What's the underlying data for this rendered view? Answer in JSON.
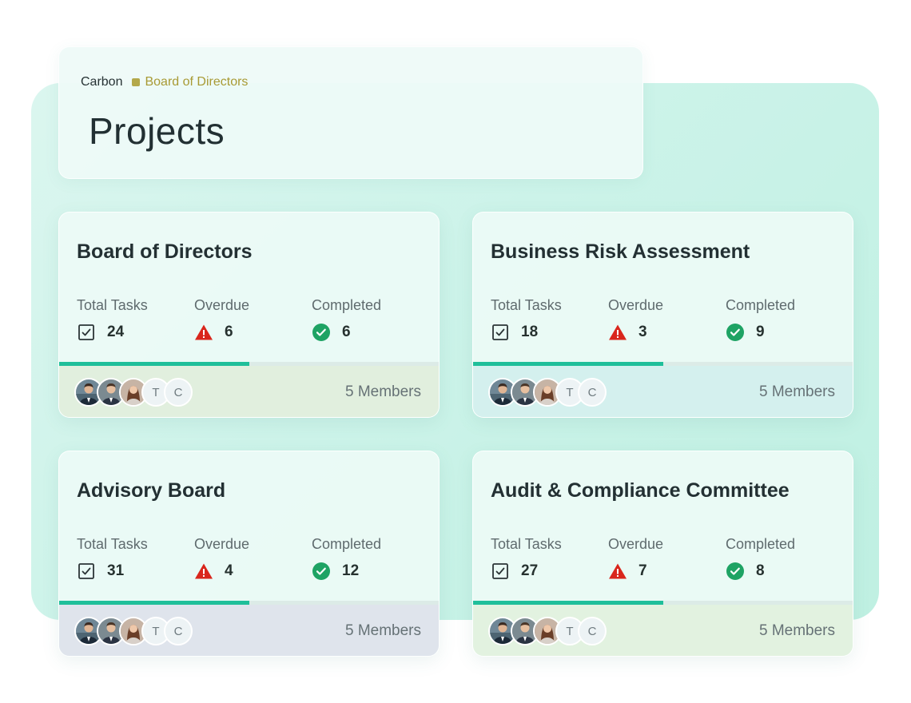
{
  "breadcrumb": {
    "root": "Carbon",
    "current": "Board of Directors",
    "dot_color": "#b3a84a"
  },
  "page": {
    "title": "Projects"
  },
  "labels": {
    "total_tasks": "Total Tasks",
    "overdue": "Overdue",
    "completed": "Completed"
  },
  "colors": {
    "accent": "#1fbf9a",
    "overdue": "#d9261c",
    "completed": "#1ea364"
  },
  "projects": [
    {
      "title": "Board of Directors",
      "total_tasks": "24",
      "overdue": "6",
      "completed": "6",
      "progress_pct": 50,
      "members": "5 Members",
      "footer_color": "#e1efde",
      "avatars": [
        "man-photo",
        "man-photo",
        "woman-photo",
        "T",
        "C"
      ]
    },
    {
      "title": "Business Risk Assessment",
      "total_tasks": "18",
      "overdue": "3",
      "completed": "9",
      "progress_pct": 50,
      "members": "5 Members",
      "footer_color": "#d4f0ee",
      "avatars": [
        "man-photo",
        "man-photo",
        "woman-photo",
        "T",
        "C"
      ]
    },
    {
      "title": "Advisory Board",
      "total_tasks": "31",
      "overdue": "4",
      "completed": "12",
      "progress_pct": 50,
      "members": "5 Members",
      "footer_color": "#dfe4ec",
      "avatars": [
        "man-photo",
        "man-photo",
        "woman-photo",
        "T",
        "C"
      ]
    },
    {
      "title": "Audit & Compliance Committee",
      "total_tasks": "27",
      "overdue": "7",
      "completed": "8",
      "progress_pct": 50,
      "members": "5 Members",
      "footer_color": "#e2f2e0",
      "avatars": [
        "man-photo",
        "man-photo",
        "woman-photo",
        "T",
        "C"
      ]
    }
  ]
}
